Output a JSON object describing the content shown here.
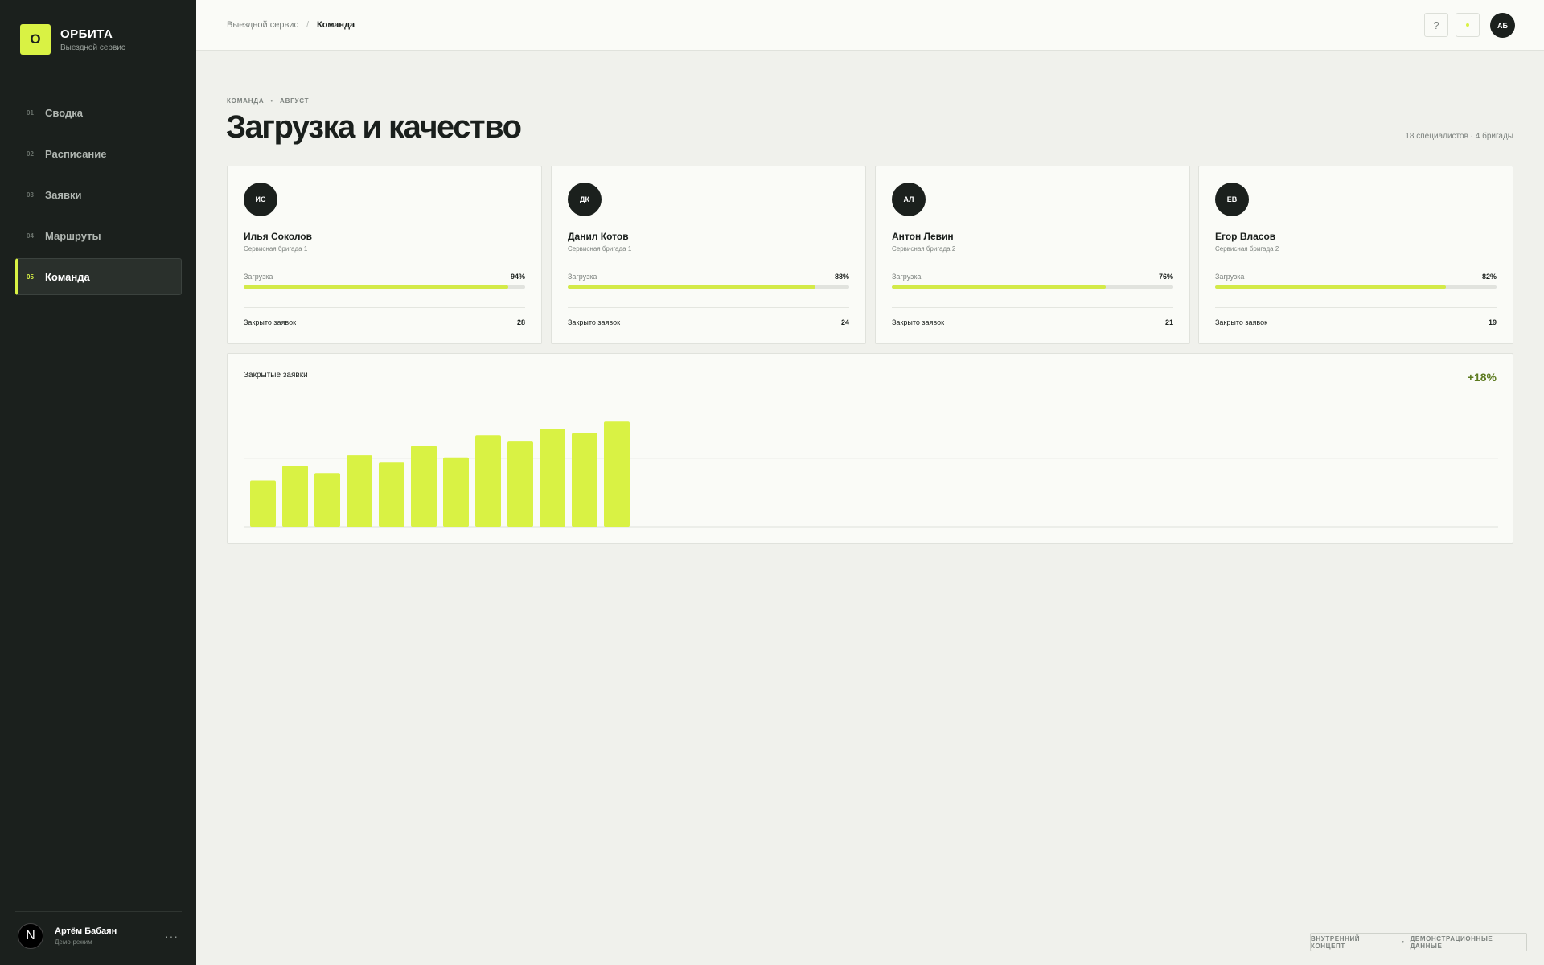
{
  "brand": {
    "mark": "О",
    "name": "ОРБИТА",
    "subtitle": "Выездной сервис"
  },
  "nav": [
    {
      "num": "01",
      "label": "Сводка"
    },
    {
      "num": "02",
      "label": "Расписание"
    },
    {
      "num": "03",
      "label": "Заявки"
    },
    {
      "num": "04",
      "label": "Маршруты"
    },
    {
      "num": "05",
      "label": "Команда",
      "active": true
    }
  ],
  "user": {
    "initial": "N",
    "name": "Артём Бабаян",
    "mode": "Демо-режим",
    "more": "···"
  },
  "breadcrumb": {
    "parent": "Выездной сервис",
    "separator": "/",
    "current": "Команда"
  },
  "topbar": {
    "help": "?",
    "avatar": "АБ"
  },
  "page": {
    "eyebrow_section": "КОМАНДА",
    "eyebrow_dot": "•",
    "eyebrow_period": "АВГУСТ",
    "title": "Загрузка и качество",
    "meta": "18 специалистов · 4 бригады"
  },
  "team": [
    {
      "initials": "ИС",
      "name": "Илья Соколов",
      "team": "Сервисная бригада 1",
      "load_label": "Загрузка",
      "load": "94%",
      "load_fraction": 0.94,
      "closed_label": "Закрыто заявок",
      "closed": "28"
    },
    {
      "initials": "ДК",
      "name": "Данил Котов",
      "team": "Сервисная бригада 1",
      "load_label": "Загрузка",
      "load": "88%",
      "load_fraction": 0.88,
      "closed_label": "Закрыто заявок",
      "closed": "24"
    },
    {
      "initials": "АЛ",
      "name": "Антон Левин",
      "team": "Сервисная бригада 2",
      "load_label": "Загрузка",
      "load": "76%",
      "load_fraction": 0.76,
      "closed_label": "Закрыто заявок",
      "closed": "21"
    },
    {
      "initials": "ЕВ",
      "name": "Егор Власов",
      "team": "Сервисная бригада 2",
      "load_label": "Загрузка",
      "load": "82%",
      "load_fraction": 0.82,
      "closed_label": "Закрыто заявок",
      "closed": "19"
    }
  ],
  "chart_panel": {
    "title": "Закрытые заявки",
    "delta": "+18%"
  },
  "chart_data": {
    "type": "bar",
    "title": "Закрытые заявки",
    "xlabel": "",
    "ylabel": "",
    "categories": [
      "",
      "",
      "",
      "",
      "",
      "",
      "",
      "",
      "",
      "",
      "",
      ""
    ],
    "values": [
      44,
      58,
      51,
      68,
      61,
      77,
      66,
      87,
      81,
      93,
      89,
      100
    ],
    "ylim": [
      0,
      130
    ],
    "grid": true,
    "bar_color": "#d9f244"
  },
  "footer": {
    "left": "ВНУТРЕННИЙ КОНЦЕПТ",
    "dot": "•",
    "right": "ДЕМОНСТРАЦИОННЫЕ ДАННЫЕ"
  },
  "colors": {
    "accent": "#d9f244",
    "sidebar": "#1b201d",
    "background": "#f0f1ec",
    "positive": "#5c7a1f"
  }
}
